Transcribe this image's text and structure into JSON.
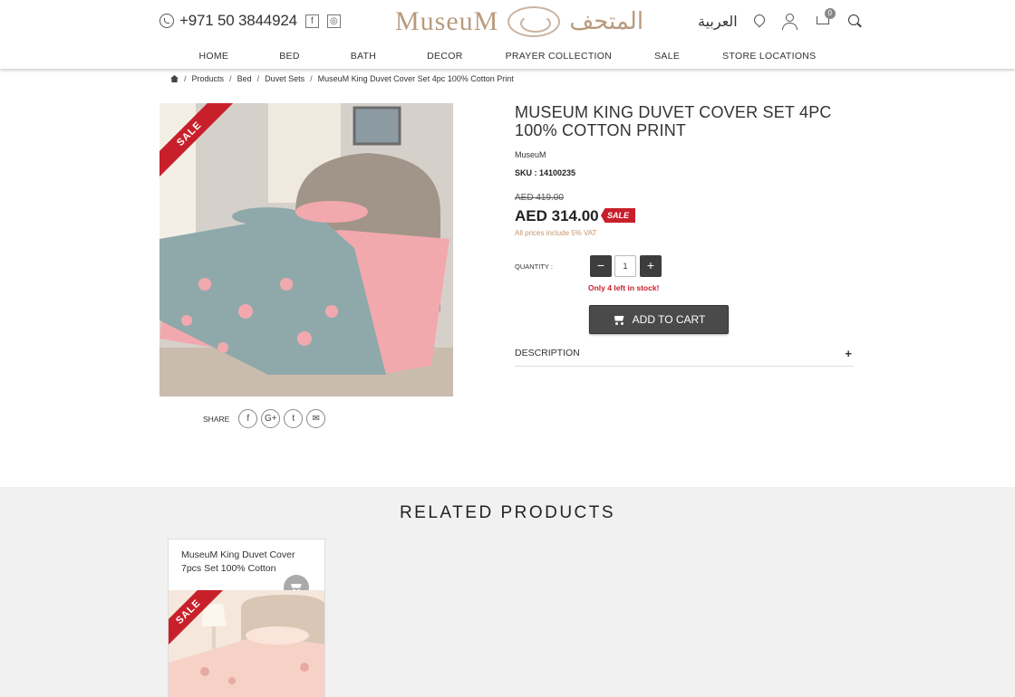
{
  "header": {
    "phone": "+971 50 3844924",
    "social": {
      "facebook": "f",
      "instagram": "◎"
    },
    "logo_en": "MuseuM",
    "logo_ar": "المتحف",
    "arabic_link": "العربية",
    "cart_count": "0",
    "icons": [
      "whatsapp-icon",
      "facebook-icon",
      "instagram-icon",
      "location-pin-icon",
      "user-icon",
      "cart-icon",
      "search-icon"
    ]
  },
  "nav": [
    "HOME",
    "BED",
    "BATH",
    "DECOR",
    "PRAYER COLLECTION",
    "SALE",
    "STORE LOCATIONS"
  ],
  "breadcrumb": [
    "Products",
    "Bed",
    "Duvet Sets",
    "MuseuM King Duvet Cover Set 4pc 100% Cotton Print"
  ],
  "product": {
    "sale_ribbon": "SALE",
    "title": "MUSEUM KING DUVET COVER SET 4PC 100% COTTON PRINT",
    "brand": "MuseuM",
    "sku": "SKU : 14100235",
    "old_price": "AED 419.00",
    "price": "AED 314.00",
    "sale_tag": "SALE",
    "vat_note": "All prices include 5% VAT",
    "quantity_label": "QUANTITY :",
    "quantity": "1",
    "minus": "−",
    "plus": "+",
    "stock": "Only 4 left in stock!",
    "add_to_cart": "ADD TO CART",
    "description_label": "DESCRIPTION",
    "description_toggle": "+",
    "share_label": "SHARE",
    "share_icons": {
      "facebook": "f",
      "google": "G+",
      "twitter": "t",
      "email": "✉"
    }
  },
  "related": {
    "title": "RELATED PRODUCTS",
    "items": [
      {
        "name": "MuseuM King Duvet Cover 7pcs Set 100% Cotton",
        "ribbon": "SALE"
      }
    ]
  },
  "colors": {
    "accent_red": "#c8202b",
    "brand_tan": "#b99a7d",
    "button_dark": "#4a4a4a",
    "vat_text": "#c8956c"
  }
}
